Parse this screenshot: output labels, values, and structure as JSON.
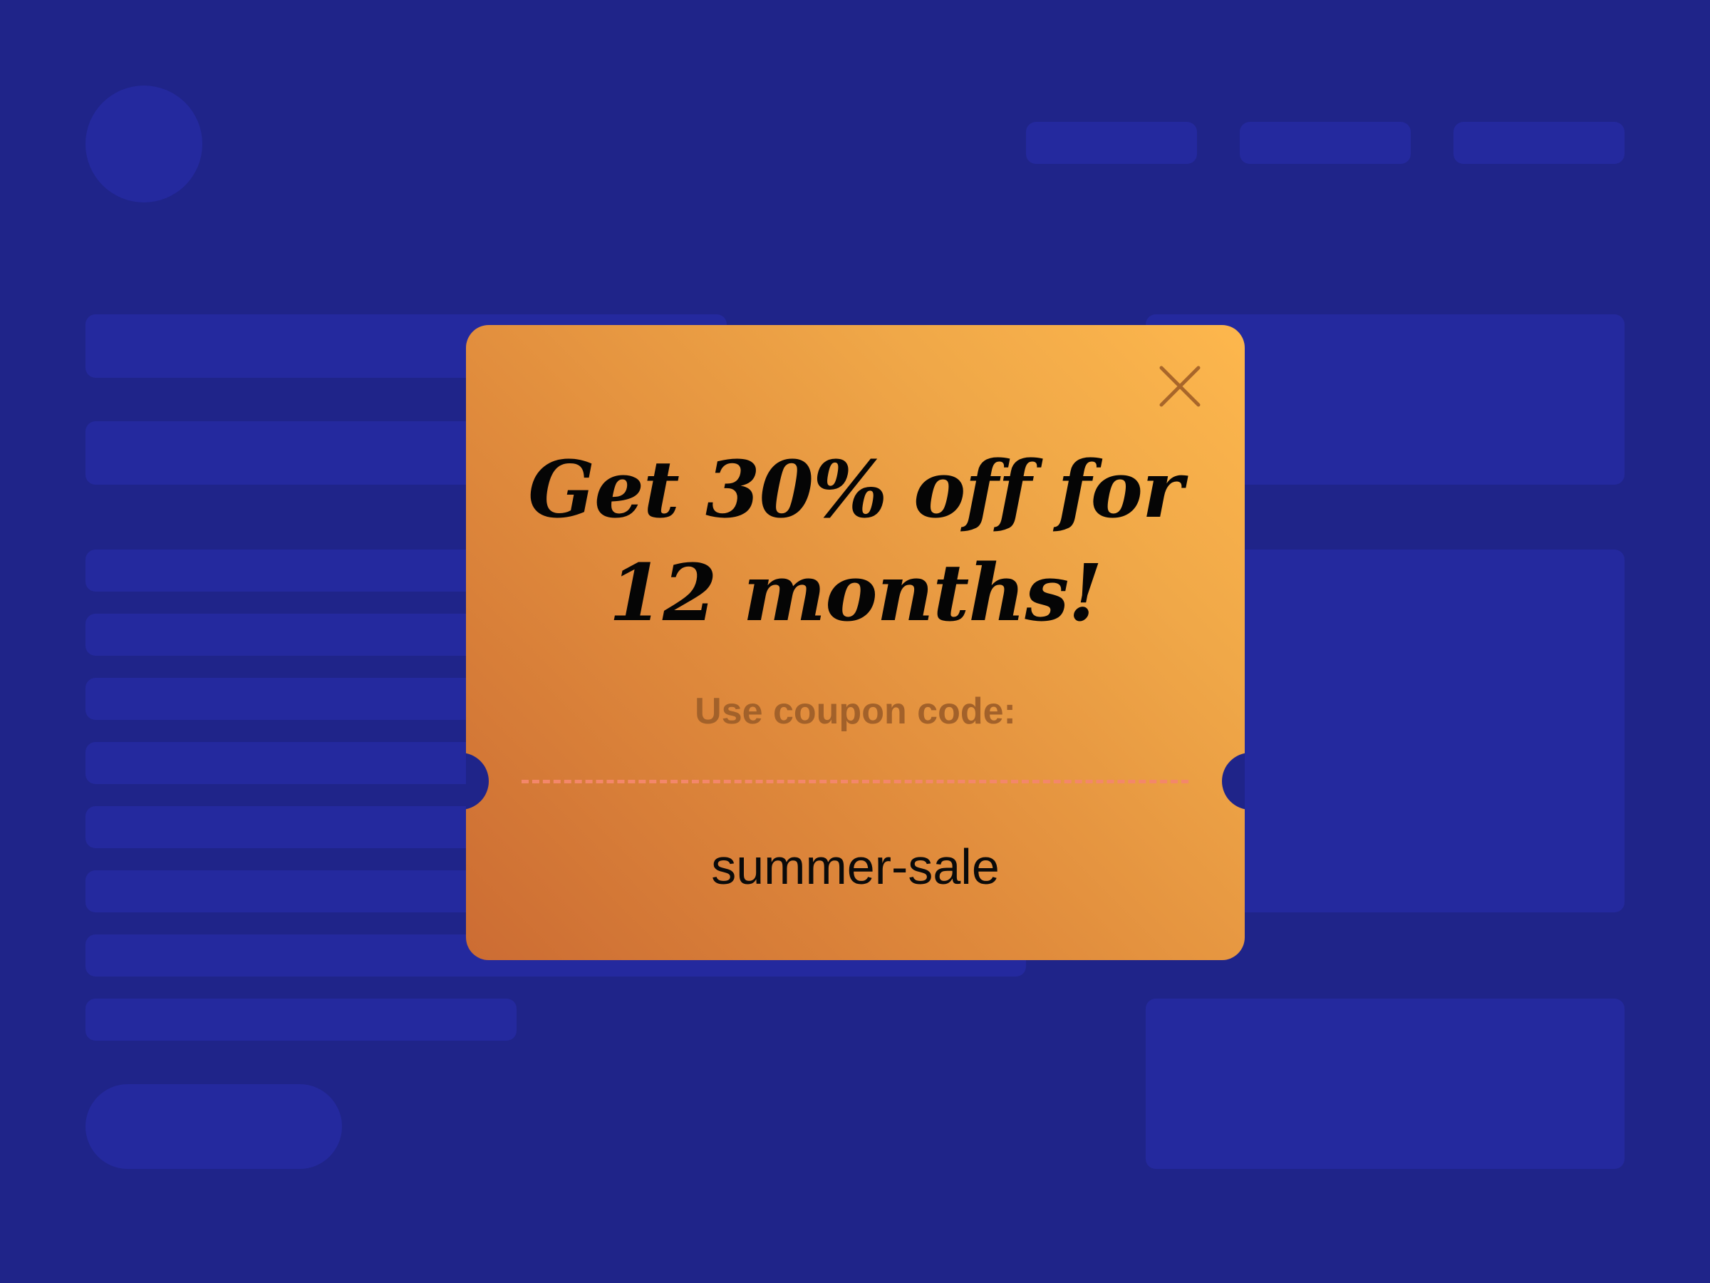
{
  "popup": {
    "headline_line1": "Get 30% off for",
    "headline_line2": "12 months!",
    "coupon_label": "Use coupon code:",
    "coupon_code": "summer-sale",
    "close_icon": "close-icon"
  },
  "colors": {
    "background": "#1f2489",
    "placeholder": "#24299e",
    "coupon_gradient_start": "#cc6c33",
    "coupon_gradient_end": "#fdb74d",
    "label_text": "#a2612a",
    "divider": "#f3876a",
    "close_icon": "#a8662a"
  }
}
